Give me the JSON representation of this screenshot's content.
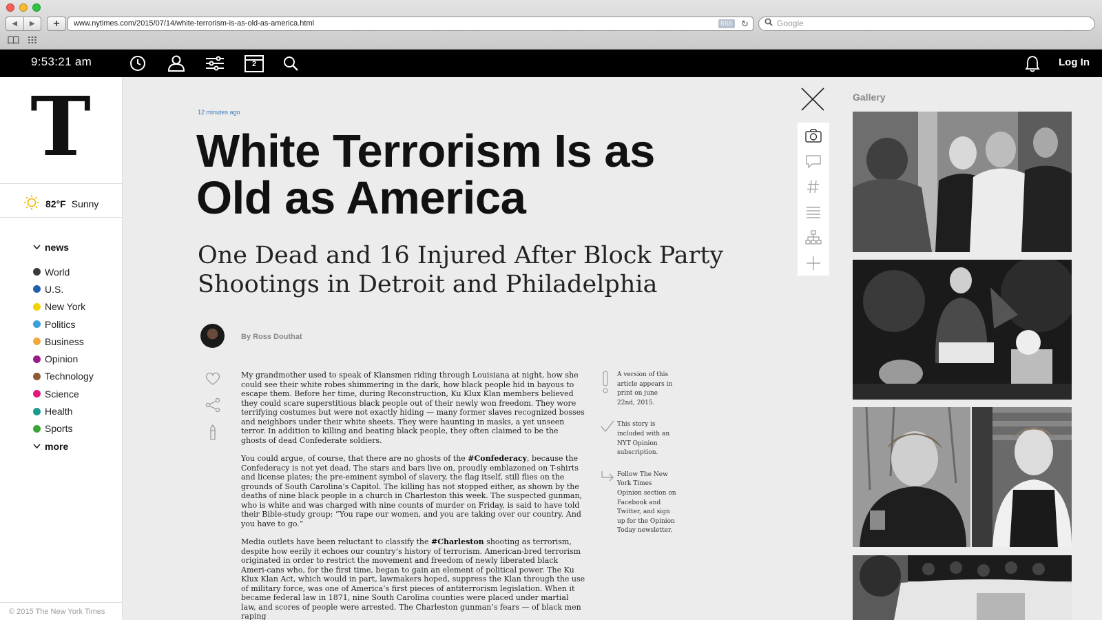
{
  "browser": {
    "url": "www.nytimes.com/2015/07/14/white-terrorism-is-as-old-as-america.html",
    "rss_label": "RSS",
    "search_placeholder": "Google"
  },
  "topbar": {
    "time": "9:53:21  am",
    "login_label": "Log In",
    "icons": [
      "clock-icon",
      "user-icon",
      "sliders-icon",
      "calendar-icon",
      "search-icon"
    ],
    "calendar_number": "2"
  },
  "sidebar": {
    "weather": {
      "temp": "82°F",
      "condition": "Sunny"
    },
    "news_label": "news",
    "items": [
      {
        "label": "World",
        "color": "#3b3b3b"
      },
      {
        "label": "U.S.",
        "color": "#1f5fae"
      },
      {
        "label": "New York",
        "color": "#f2d200"
      },
      {
        "label": "Politics",
        "color": "#3aa0dc"
      },
      {
        "label": "Business",
        "color": "#f2a93b"
      },
      {
        "label": "Opinion",
        "color": "#9b1a8a"
      },
      {
        "label": "Technology",
        "color": "#8c5a34"
      },
      {
        "label": "Science",
        "color": "#e2197c"
      },
      {
        "label": "Health",
        "color": "#1b9a8e"
      },
      {
        "label": "Sports",
        "color": "#3aa63a"
      }
    ],
    "more_label": "more",
    "copyright": "© 2015 The New York Times"
  },
  "article": {
    "timestamp": "12 minutes ago",
    "headline_line1": "White Terrorism Is as",
    "headline_line2": "Old as America",
    "subhead_line1": "One Dead and 16 Injured After Block Party",
    "subhead_line2": "Shootings in Detroit and Philadelphia",
    "byline": "By Ross Douthat",
    "p1": "My grandmother used to speak of Klansmen riding through Louisiana at night, how she could see their white robes shimmering in the dark, how black people hid in bayous to escape them. Before her time, during Reconstruction, Ku Klux Klan members believed they could scare superstitious black people out of their newly won freedom. They wore terrifying costumes but were not exactly hiding — many former slaves recognized bosses and neighbors under their white sheets. They were haunting in masks, a yet unseen terror. In addition to killing and beating black people, they often claimed to be the ghosts of dead Confederate soldiers.",
    "p2_a": "You could argue, of course, that there are no ghosts of the ",
    "p2_tag": "#Confederacy",
    "p2_b": ", because the Confederacy is not yet dead. The stars and bars live on, proudly emblazoned on T-shirts and license plates; the pre-eminent symbol of slavery, the flag itself, still flies on the grounds of South Carolina’s Capitol. The killing has not stopped either, as shown by the deaths of nine black people in a church in Charleston this week. The suspected gunman, who is white and was charged with nine counts of murder on Friday, is said to have told their Bible-study group: “You rape our women, and you are taking over our country. And you have to go.”",
    "p3_a": "Media outlets have been reluctant to classify the ",
    "p3_tag": "#Charleston",
    "p3_b": " shooting as terrorism, despite how eerily it echoes our country’s history of terrorism. American-bred terrorism originated in order to restrict the movement and freedom of newly liberated black Ameri-cans who, for the first time, began to gain an element of political power. The Ku Klux Klan Act, which would in part, lawmakers hoped, suppress the Klan through the use of military force, was one of America’s first pieces of antiterrorism legislation. When it became federal law in 1871, nine South Carolina counties were placed under martial law, and scores of people were arrested. The Charleston gunman’s fears — of black men raping",
    "notes": [
      "A version of this article appears in print on june 22nd, 2015.",
      "This story is included with an NYT Opinion subscription.",
      "Follow The New York Times Opinion section on Facebook and Twitter, and sign up for the Opinion Today newsletter."
    ]
  },
  "gallery": {
    "title": "Gallery"
  },
  "colors": {
    "topbar_bg": "#000000",
    "timestamp": "#3a7bbf",
    "page_bg": "#ececec"
  }
}
